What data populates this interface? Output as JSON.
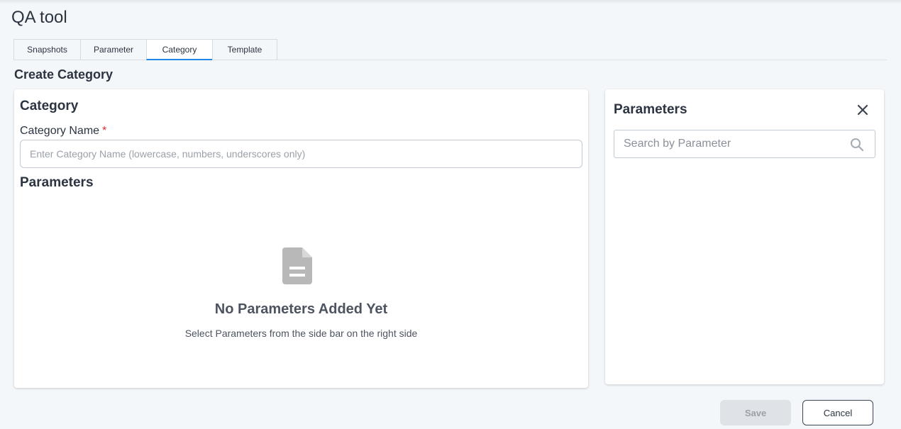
{
  "app": {
    "title": "QA tool"
  },
  "tabs": [
    {
      "label": "Snapshots"
    },
    {
      "label": "Parameter"
    },
    {
      "label": "Category",
      "active": true
    },
    {
      "label": "Template"
    }
  ],
  "page": {
    "title": "Create Category"
  },
  "form": {
    "section_title": "Category",
    "name_label": "Category Name",
    "required_marker": "*",
    "name_value": "",
    "name_placeholder": "Enter Category Name (lowercase, numbers, underscores only)",
    "params_title": "Parameters",
    "empty_icon": "document-icon",
    "empty_title": "No Parameters Added Yet",
    "empty_subtitle": "Select Parameters from the side bar on the right side"
  },
  "sidebar": {
    "title": "Parameters",
    "close_icon": "close-icon",
    "search_value": "",
    "search_placeholder": "Search by Parameter",
    "search_icon": "search-icon"
  },
  "actions": {
    "save_label": "Save",
    "save_disabled": true,
    "cancel_label": "Cancel"
  },
  "colors": {
    "accent": "#1e88e5",
    "required": "#d32f2f",
    "background": "#f4f7fa"
  }
}
